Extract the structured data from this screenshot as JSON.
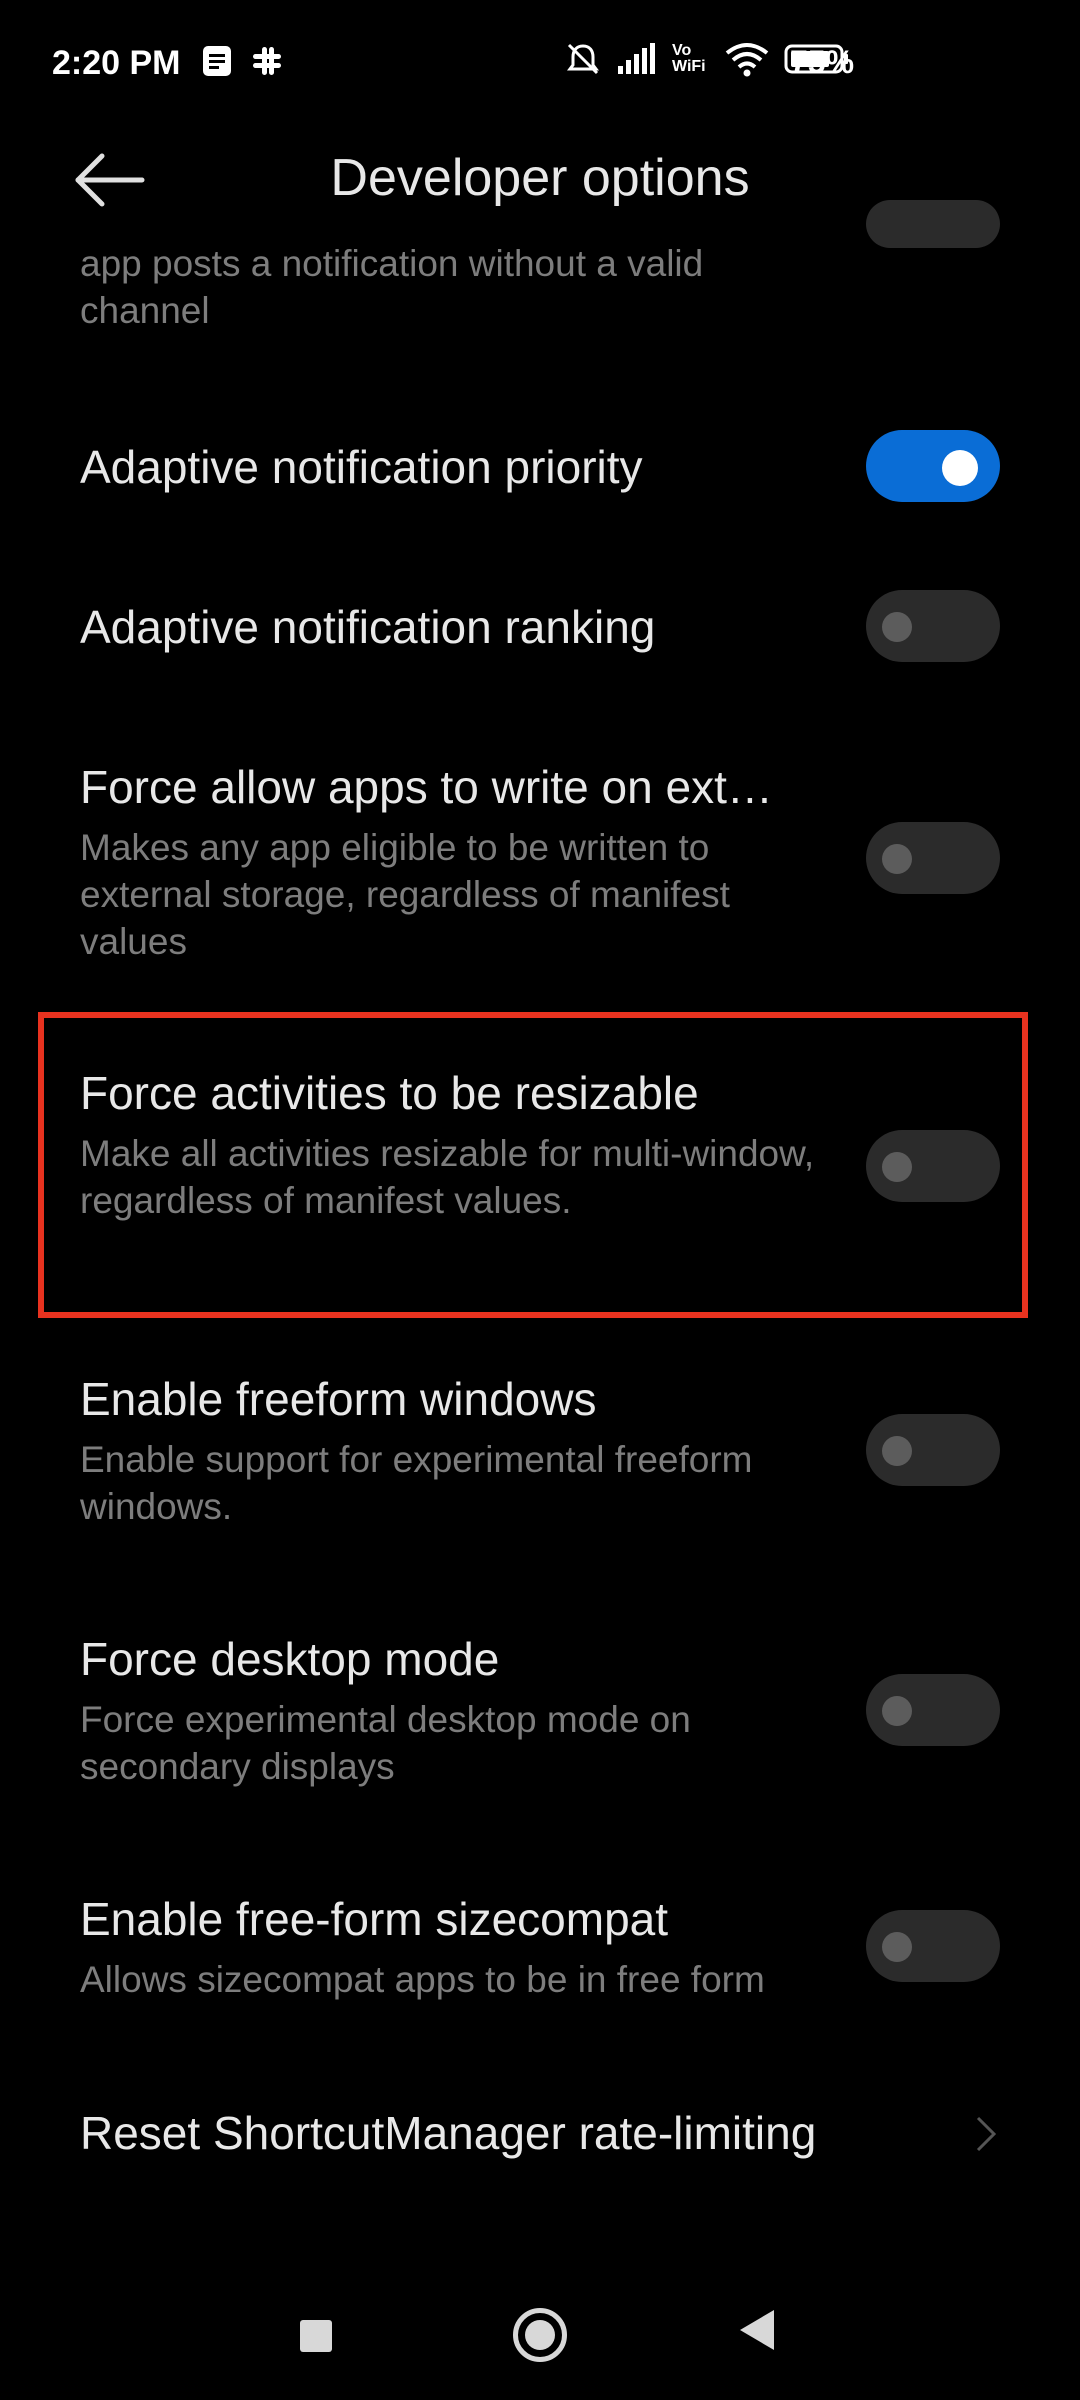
{
  "status_bar": {
    "time": "2:20 PM",
    "battery_percent": "75%",
    "network_label": "Vo WiFi"
  },
  "app_bar": {
    "title": "Developer options"
  },
  "list": {
    "partial_item": {
      "subtitle": "app posts a notification without a valid channel"
    },
    "items": [
      {
        "title": "Adaptive notification priority",
        "subtitle": "",
        "toggle_on": true
      },
      {
        "title": "Adaptive notification ranking",
        "subtitle": "",
        "toggle_on": false
      },
      {
        "title": "Force allow apps to write on ext…",
        "subtitle": "Makes any app eligible to be written to external storage, regardless of manifest values",
        "toggle_on": false
      },
      {
        "title": "Force activities to be resizable",
        "subtitle": "Make all activities resizable for multi-window, regardless of manifest values.",
        "toggle_on": false
      },
      {
        "title": "Enable freeform windows",
        "subtitle": "Enable support for experimental freeform windows.",
        "toggle_on": false
      },
      {
        "title": "Force desktop mode",
        "subtitle": "Force experimental desktop mode on secondary displays",
        "toggle_on": false
      },
      {
        "title": "Enable free-form sizecompat",
        "subtitle": "Allows sizecompat apps to be in free form",
        "toggle_on": false
      },
      {
        "title": "Reset ShortcutManager rate-limiting",
        "subtitle": ""
      }
    ]
  },
  "colors": {
    "accent": "#0a6dd6",
    "highlight": "#e8321f",
    "background": "#000000"
  }
}
